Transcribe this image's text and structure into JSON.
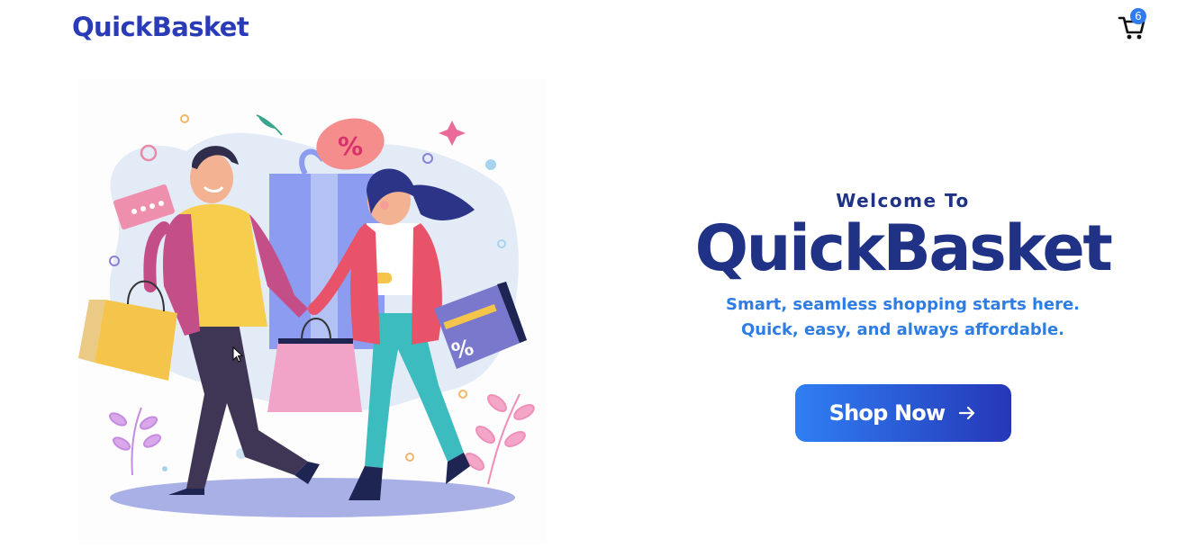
{
  "navbar": {
    "brand": "QuickBasket",
    "cart_icon": "shopping-cart-icon",
    "cart_count": "6"
  },
  "hero": {
    "illustration": "shopping-couple-illustration",
    "illustration_badges": {
      "top_tag": "%",
      "bag_tag": "%"
    },
    "welcome": "Welcome To",
    "title": "QuickBasket",
    "tagline_line1": "Smart, seamless shopping starts here.",
    "tagline_line2": "Quick, easy, and always affordable.",
    "cta_label": "Shop Now",
    "cta_icon": "arrow-right-icon"
  },
  "colors": {
    "brand": "#2a3bb7",
    "title": "#1f3285",
    "tagline": "#2e7de4",
    "button_start": "#2f7ff3",
    "button_end": "#2537b8",
    "badge": "#2f7bf0"
  }
}
